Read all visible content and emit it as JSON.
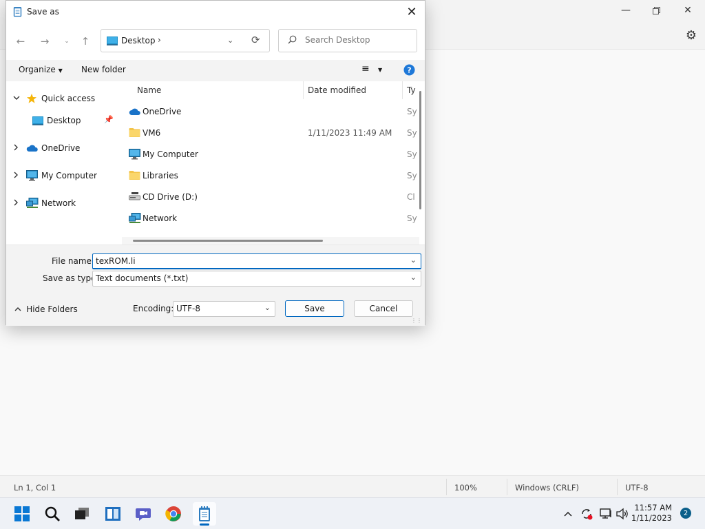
{
  "notepad": {
    "status": {
      "position": "Ln 1, Col 1",
      "zoom": "100%",
      "line_ending": "Windows (CRLF)",
      "encoding": "UTF-8"
    },
    "icons": [
      "minimize-icon",
      "maximize-icon",
      "close-icon",
      "gear-icon"
    ]
  },
  "dialog": {
    "title": "Save as",
    "address": {
      "location": "Desktop",
      "breadcrumb_sep": "›"
    },
    "search": {
      "placeholder": "Search Desktop"
    },
    "toolbar": {
      "organize": "Organize",
      "new_folder": "New folder"
    },
    "sidebar": {
      "items": [
        {
          "label": "Quick access",
          "icon": "star-icon",
          "expanded": true
        },
        {
          "label": "Desktop",
          "icon": "desktop-icon",
          "pinned": true
        },
        {
          "label": "OneDrive",
          "icon": "cloud-icon"
        },
        {
          "label": "My Computer",
          "icon": "monitor-icon"
        },
        {
          "label": "Network",
          "icon": "network-icon"
        }
      ]
    },
    "columns": {
      "name": "Name",
      "date": "Date modified",
      "type": "Ty"
    },
    "files": [
      {
        "name": "OneDrive",
        "date": "",
        "type": "Sy",
        "icon": "cloud-icon"
      },
      {
        "name": "VM6",
        "date": "1/11/2023 11:49 AM",
        "type": "Sy",
        "icon": "folder-icon"
      },
      {
        "name": "My Computer",
        "date": "",
        "type": "Sy",
        "icon": "monitor-icon"
      },
      {
        "name": "Libraries",
        "date": "",
        "type": "Sy",
        "icon": "folder-icon"
      },
      {
        "name": "CD Drive (D:)",
        "date": "",
        "type": "Cl",
        "icon": "cd-drive-icon"
      },
      {
        "name": "Network",
        "date": "",
        "type": "Sy",
        "icon": "network-icon"
      }
    ],
    "file_name_label": "File name:",
    "file_name_value": "texROM.li",
    "save_type_label": "Save as type:",
    "save_type_value": "Text documents (*.txt)",
    "hide_folders": "Hide Folders",
    "encoding_label": "Encoding:",
    "encoding_value": "UTF-8",
    "save_button": "Save",
    "cancel_button": "Cancel"
  },
  "taskbar": {
    "apps": [
      "start-icon",
      "search-icon",
      "task-view-icon",
      "widgets-icon",
      "teams-chat-icon",
      "chrome-icon",
      "notepad-icon"
    ],
    "time": "11:57 AM",
    "date": "1/11/2023",
    "notification_count": "2",
    "accent": "#0067c0"
  }
}
